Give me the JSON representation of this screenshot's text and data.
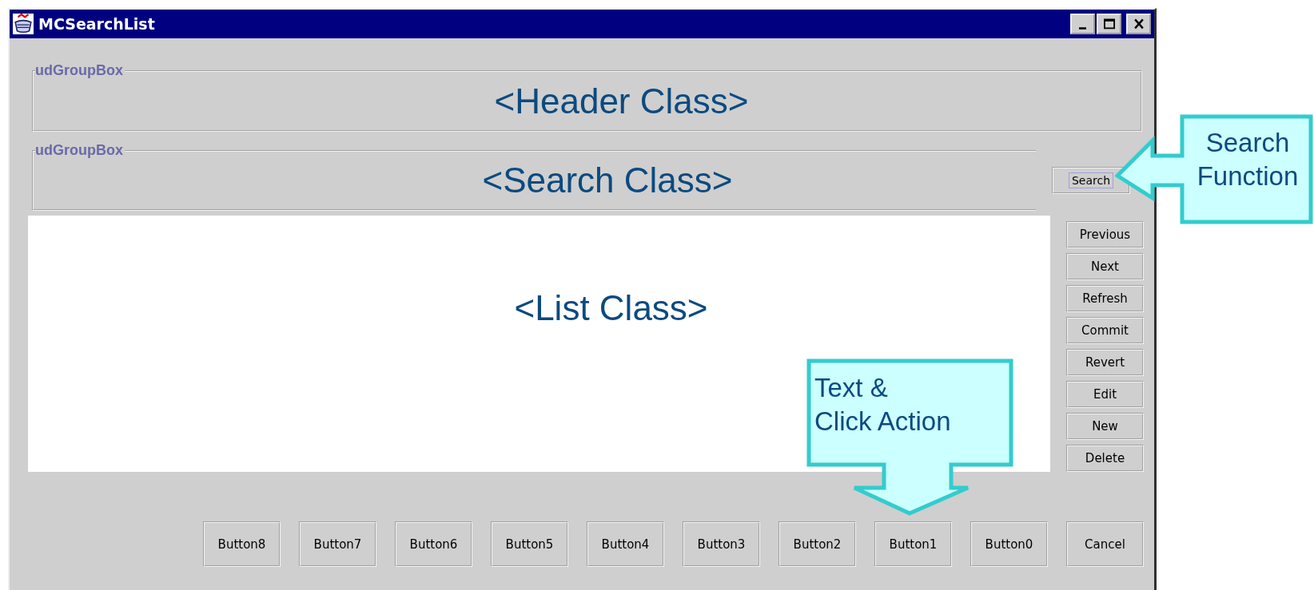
{
  "window": {
    "title": "MCSearchList"
  },
  "header_group": {
    "label": "udGroupBox",
    "content": "<Header Class>"
  },
  "search_group": {
    "label": "udGroupBox",
    "content": "<Search Class>"
  },
  "search_button": "Search",
  "list": {
    "content": "<List Class>"
  },
  "side_buttons": [
    "Previous",
    "Next",
    "Refresh",
    "Commit",
    "Revert",
    "Edit",
    "New",
    "Delete"
  ],
  "bottom_buttons": [
    "Button8",
    "Button7",
    "Button6",
    "Button5",
    "Button4",
    "Button3",
    "Button2",
    "Button1",
    "Button0",
    "Cancel"
  ],
  "callouts": [
    {
      "kind": "left",
      "lines": [
        "Search",
        "Function"
      ]
    },
    {
      "kind": "down",
      "lines": [
        "Text &",
        "Click Action"
      ]
    }
  ]
}
